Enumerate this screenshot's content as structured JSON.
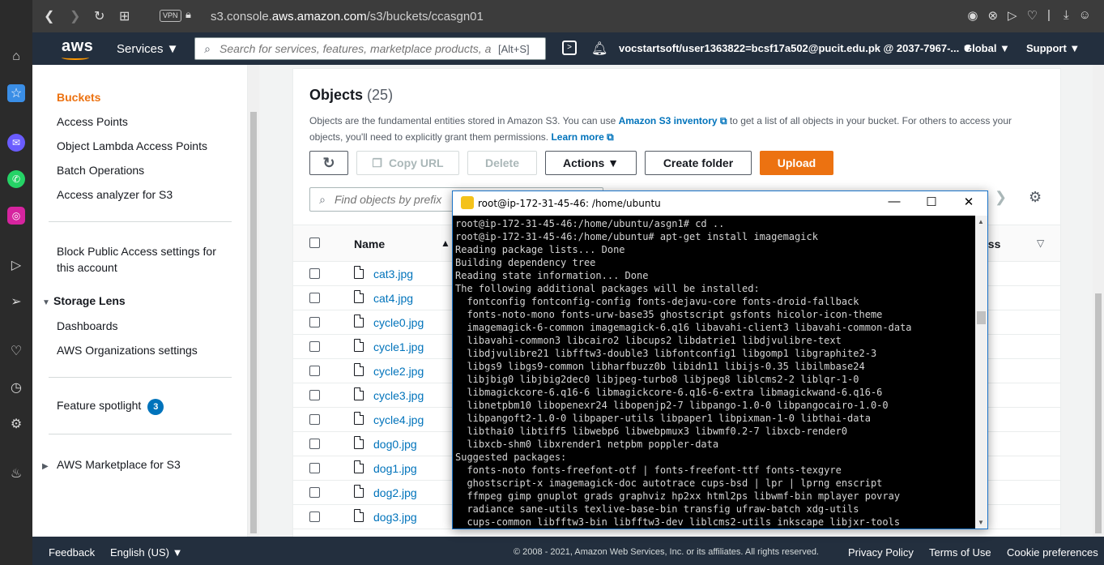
{
  "browser": {
    "url_prefix": "s3.console.",
    "url_domain": "aws.amazon.com",
    "url_path": "/s3/buckets/ccasgn01",
    "vpn_label": "VPN"
  },
  "aws_nav": {
    "logo": "aws",
    "services_label": "Services ▼",
    "search_placeholder": "Search for services, features, marketplace products, a",
    "search_shortcut": "[Alt+S]",
    "account": "vocstartsoft/user1363822=bcsf17a502@pucit.edu.pk @ 2037-7967-... ▼",
    "region": "Global ▼",
    "support": "Support ▼"
  },
  "sidebar": {
    "items": [
      {
        "label": "Buckets"
      },
      {
        "label": "Access Points"
      },
      {
        "label": "Object Lambda Access Points"
      },
      {
        "label": "Batch Operations"
      },
      {
        "label": "Access analyzer for S3"
      },
      {
        "label": "Block Public Access settings for"
      },
      {
        "label": "this account"
      },
      {
        "label": "Dashboards"
      },
      {
        "label": "AWS Organizations settings"
      },
      {
        "label": "Feature spotlight"
      }
    ],
    "storage_lens": "Storage Lens",
    "feature_count": "3",
    "marketplace": "AWS Marketplace for S3"
  },
  "objects": {
    "title": "Objects",
    "count": "(25)",
    "desc_1": "Objects are the fundamental entities stored in Amazon S3. You can use ",
    "desc_link": "Amazon S3 inventory",
    "desc_2": " to get a list of all objects in your bucket. For others to access your objects, you'll need to explicitly grant them permissions. ",
    "learn_more": "Learn more",
    "buttons": {
      "copy_url": "Copy URL",
      "delete": "Delete",
      "actions": "Actions ▼",
      "create_folder": "Create folder",
      "upload": "Upload"
    },
    "find_placeholder": "Find objects by prefix",
    "columns": {
      "name": "Name",
      "class": "ass"
    },
    "files": [
      "cat3.jpg",
      "cat4.jpg",
      "cycle0.jpg",
      "cycle1.jpg",
      "cycle2.jpg",
      "cycle3.jpg",
      "cycle4.jpg",
      "dog0.jpg",
      "dog1.jpg",
      "dog2.jpg",
      "dog3.jpg"
    ]
  },
  "terminal": {
    "title": "root@ip-172-31-45-46: /home/ubuntu",
    "lines": [
      "root@ip-172-31-45-46:/home/ubuntu/asgn1# cd ..",
      "root@ip-172-31-45-46:/home/ubuntu# apt-get install imagemagick",
      "Reading package lists... Done",
      "Building dependency tree",
      "Reading state information... Done",
      "The following additional packages will be installed:",
      "  fontconfig fontconfig-config fonts-dejavu-core fonts-droid-fallback",
      "  fonts-noto-mono fonts-urw-base35 ghostscript gsfonts hicolor-icon-theme",
      "  imagemagick-6-common imagemagick-6.q16 libavahi-client3 libavahi-common-data",
      "  libavahi-common3 libcairo2 libcups2 libdatrie1 libdjvulibre-text",
      "  libdjvulibre21 libfftw3-double3 libfontconfig1 libgomp1 libgraphite2-3",
      "  libgs9 libgs9-common libharfbuzz0b libidn11 libijs-0.35 libilmbase24",
      "  libjbig0 libjbig2dec0 libjpeg-turbo8 libjpeg8 liblcms2-2 liblqr-1-0",
      "  libmagickcore-6.q16-6 libmagickcore-6.q16-6-extra libmagickwand-6.q16-6",
      "  libnetpbm10 libopenexr24 libopenjp2-7 libpango-1.0-0 libpangocairo-1.0-0",
      "  libpangoft2-1.0-0 libpaper-utils libpaper1 libpixman-1-0 libthai-data",
      "  libthai0 libtiff5 libwebp6 libwebpmux3 libwmf0.2-7 libxcb-render0",
      "  libxcb-shm0 libxrender1 netpbm poppler-data",
      "Suggested packages:",
      "  fonts-noto fonts-freefont-otf | fonts-freefont-ttf fonts-texgyre",
      "  ghostscript-x imagemagick-doc autotrace cups-bsd | lpr | lprng enscript",
      "  ffmpeg gimp gnuplot grads graphviz hp2xx html2ps libwmf-bin mplayer povray",
      "  radiance sane-utils texlive-base-bin transfig ufraw-batch xdg-utils",
      "  cups-common libfftw3-bin libfftw3-dev liblcms2-utils inkscape libjxr-tools"
    ]
  },
  "footer": {
    "feedback": "Feedback",
    "language": "English (US) ▼",
    "copyright": "© 2008 - 2021, Amazon Web Services, Inc. or its affiliates. All rights reserved.",
    "privacy": "Privacy Policy",
    "terms": "Terms of Use",
    "cookies": "Cookie preferences"
  },
  "colors": {
    "accent": "#ec7211",
    "nav": "#232f3e",
    "link": "#0073bb"
  }
}
